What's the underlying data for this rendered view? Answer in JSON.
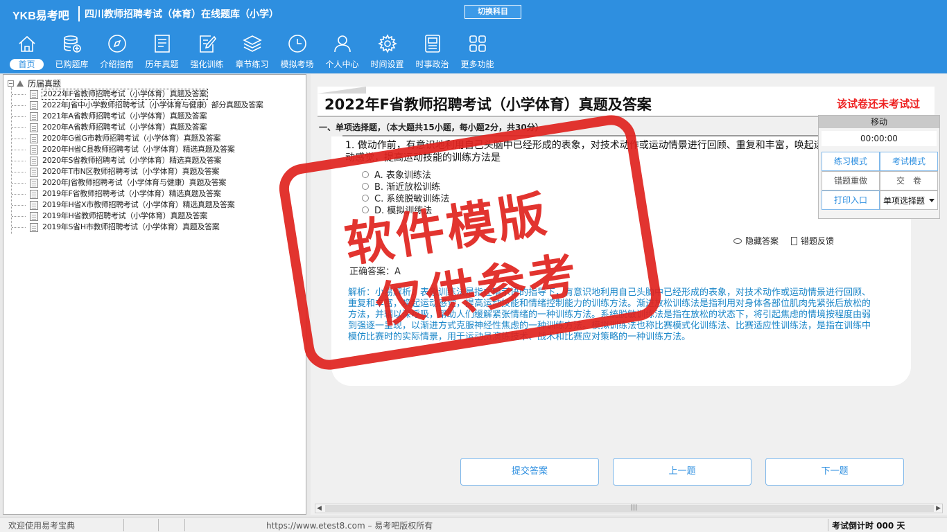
{
  "header": {
    "logo": "YKB易考吧",
    "title": "四川教师招聘考试（体育）在线题库（小学）",
    "switch_subject": "切换科目"
  },
  "nav": [
    {
      "label": "首页",
      "icon": "home-icon",
      "active": true
    },
    {
      "label": "已购题库",
      "icon": "database-icon"
    },
    {
      "label": "介绍指南",
      "icon": "compass-icon"
    },
    {
      "label": "历年真题",
      "icon": "list-doc-icon"
    },
    {
      "label": "强化训练",
      "icon": "edit-doc-icon"
    },
    {
      "label": "章节练习",
      "icon": "layers-icon"
    },
    {
      "label": "模拟考场",
      "icon": "clock-icon"
    },
    {
      "label": "个人中心",
      "icon": "user-icon"
    },
    {
      "label": "时间设置",
      "icon": "gear-icon"
    },
    {
      "label": "时事政治",
      "icon": "newspaper-icon"
    },
    {
      "label": "更多功能",
      "icon": "grid-icon"
    }
  ],
  "tree": {
    "root": "历届真题",
    "items": [
      "2022年F省教师招聘考试（小学体育）真题及答案",
      "2022年J省中小学教师招聘考试（小学体育与健康）部分真题及答案",
      "2021年A省教师招聘考试（小学体育）真题及答案",
      "2020年A省教师招聘考试（小学体育）真题及答案",
      "2020年G省G市教师招聘考试（小学体育）真题及答案",
      "2020年H省C县教师招聘考试（小学体育）精选真题及答案",
      "2020年S省教师招聘考试（小学体育）精选真题及答案",
      "2020年T市N区教师招聘考试（小学体育）真题及答案",
      "2020年J省教师招聘考试（小学体育与健康）真题及答案",
      "2019年F省教师招聘考试（小学体育）精选真题及答案",
      "2019年H省X市教师招聘考试（小学体育）精选真题及答案",
      "2019年H省教师招聘考试（小学体育）真题及答案",
      "2019年S省H市教师招聘考试（小学体育）真题及答案"
    ]
  },
  "paper": {
    "title": "2022年F省教师招聘考试（小学体育）真题及答案",
    "status": "该试卷还未考试过"
  },
  "section": {
    "heading": "一、单项选择题，（本大题共15小题，每小题2分，共30分）"
  },
  "question": {
    "text": "1. 做动作前，有意识地利用自己头脑中已经形成的表象，对技术动作或运动情景进行回顾、重复和丰富，唤起运动感觉，提高运动技能的训练方法是",
    "options": [
      "A. 表象训练法",
      "B. 渐近放松训练",
      "C. 系统脱敏训练法",
      "D. 模拟训练法"
    ]
  },
  "answer_tools": {
    "hide": "隐藏答案",
    "feedback": "错题反馈"
  },
  "answer_line": "正确答案：A",
  "analysis": "解析：小易解析：表象训练法是指在暗示语的指导下，有意识地利用自己头脑中已经形成的表象，对技术动作或运动情景进行回顾、重复和丰富，唤起运动感觉，提高运动技能和情绪控制能力的训练方法。渐进放松训练法是指利用对身体各部位肌肉先紧张后放松的方法，并辅以深呼吸，帮助人们缓解紧张情绪的一种训练方法。系统脱敏训练法是指在放松的状态下，将引起焦虑的情境按程度由弱到强逐一呈现，以渐进方式克服神经性焦虑的一种训练方法。模拟训练法也称比赛模式化训练法、比赛适应性训练法，是指在训练中模仿比赛时的实际情景，用于运动员演练技术、战术和比赛应对策略的一种训练方法。",
  "float_panel": {
    "move": "移动",
    "timer": "00:00:00",
    "practice_mode": "练习模式",
    "exam_mode": "考试模式",
    "redo_wrong": "错题重做",
    "submit": "交　卷",
    "print": "打印入口",
    "qtype": "单项选择题"
  },
  "bottom_buttons": {
    "submit_answer": "提交答案",
    "prev": "上一题",
    "next": "下一题"
  },
  "statusbar": {
    "welcome": "欢迎使用易考宝典",
    "copyright": "https://www.etest8.com – 易考吧版权所有",
    "countdown": "考试倒计时 000 天"
  },
  "watermark": {
    "line1": "软件模版",
    "line2": "仅供参考"
  },
  "colors": {
    "header_bg": "#2e8fe0",
    "accent": "#2e8fe0",
    "status_red": "#e22222",
    "analysis_blue": "#1a86c8",
    "stamp_red": "#e0231e"
  }
}
